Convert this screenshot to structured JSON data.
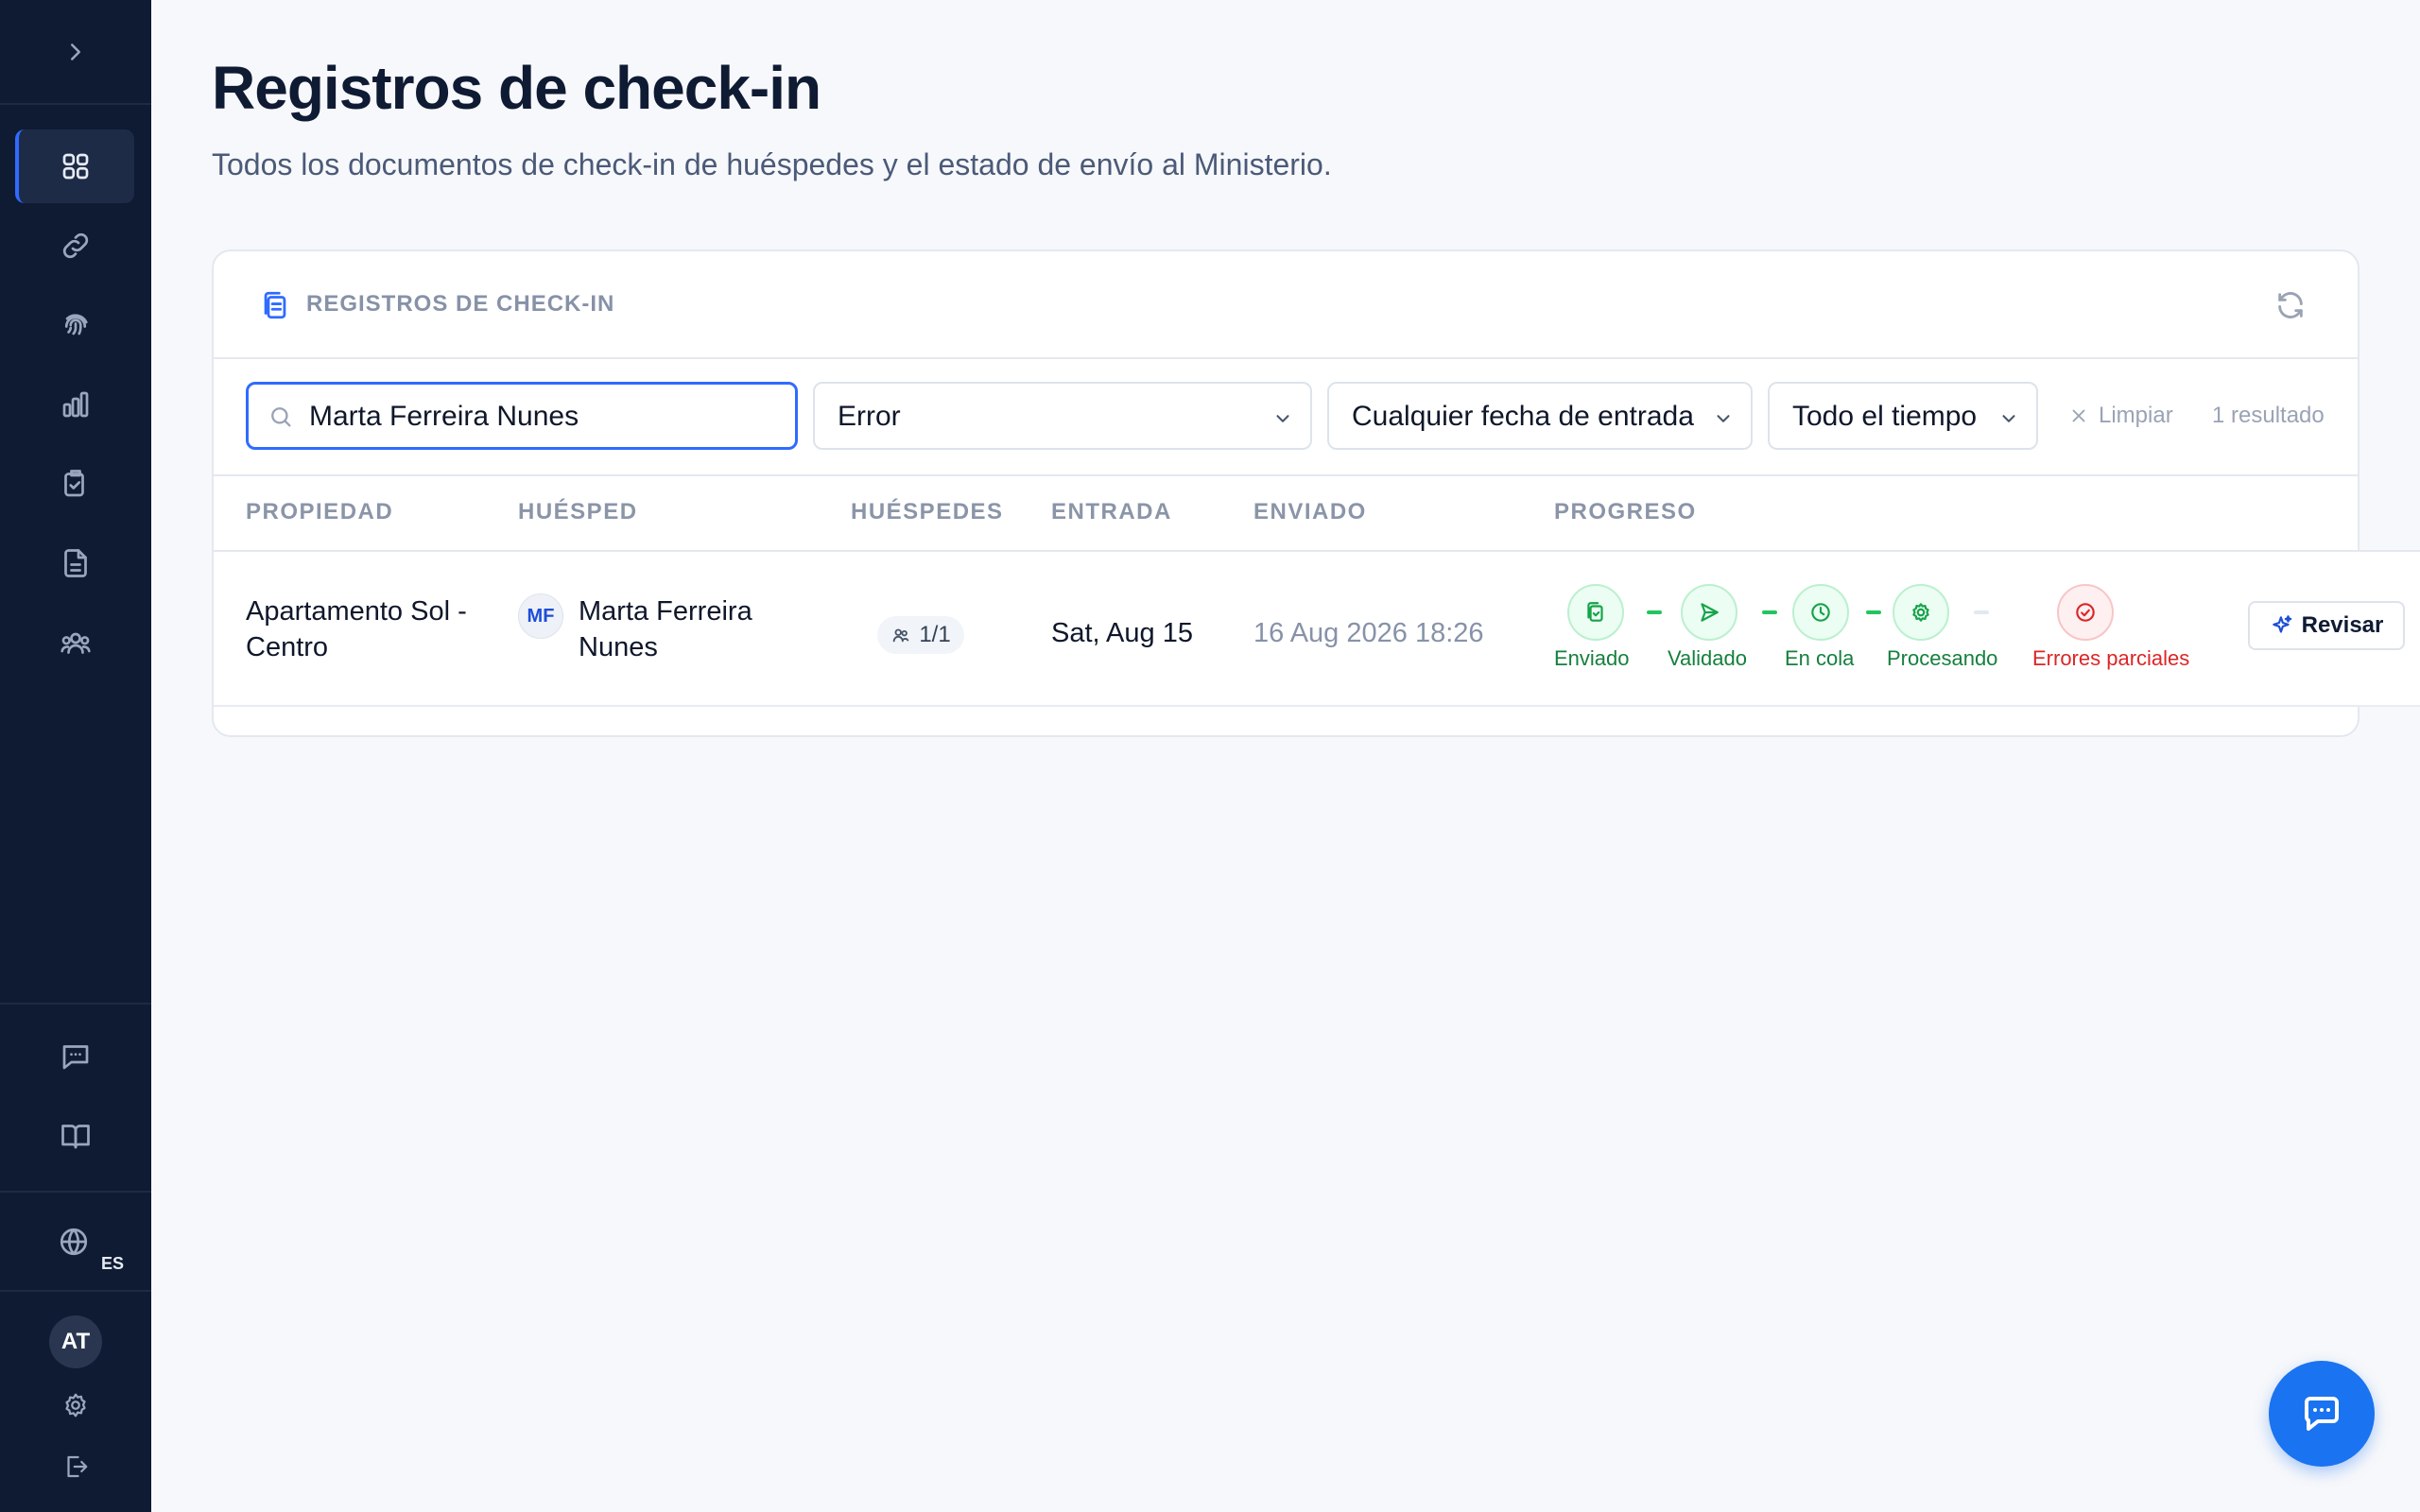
{
  "page": {
    "title": "Registros de check-in",
    "subtitle": "Todos los documentos de check-in de huéspedes y el estado de envío al Ministerio."
  },
  "sidebar": {
    "items": [
      {
        "icon": "expand-chevron-icon"
      },
      {
        "icon": "dashboard-icon",
        "active": true
      },
      {
        "icon": "link-icon"
      },
      {
        "icon": "fingerprint-icon"
      },
      {
        "icon": "bar-chart-icon"
      },
      {
        "icon": "clipboard-check-icon"
      },
      {
        "icon": "document-icon"
      },
      {
        "icon": "users-icon"
      },
      {
        "icon": "chat-icon"
      },
      {
        "icon": "book-icon"
      },
      {
        "icon": "globe-icon"
      }
    ],
    "language": "ES",
    "user_initials": "AT"
  },
  "card": {
    "title": "REGISTROS DE CHECK-IN"
  },
  "filters": {
    "search_value": "Marta Ferreira Nunes",
    "status": "Error",
    "entry_date": "Cualquier fecha de entrada",
    "period": "Todo el tiempo",
    "clear_label": "Limpiar",
    "result_count": "1 resultado"
  },
  "table": {
    "headers": [
      "PROPIEDAD",
      "HUÉSPED",
      "HUÉSPEDES",
      "ENTRADA",
      "ENVIADO",
      "PROGRESO"
    ],
    "rows": [
      {
        "property": "Apartamento Sol - Centro",
        "guest_initials": "MF",
        "guest": "Marta Ferreira Nunes",
        "guests": "1/1",
        "entry": "Sat, Aug 15",
        "sent": "16 Aug 2026 18:26",
        "progress": [
          {
            "label": "Enviado",
            "status": "done"
          },
          {
            "label": "Validado",
            "status": "done"
          },
          {
            "label": "En cola",
            "status": "done"
          },
          {
            "label": "Procesando",
            "status": "done"
          },
          {
            "label": "Errores parciales",
            "status": "error"
          }
        ],
        "action": "Revisar"
      }
    ]
  },
  "colors": {
    "sidebar_bg": "#0f1b33",
    "accent": "#2f6bff",
    "success": "#16a34a",
    "error": "#dc2626"
  }
}
